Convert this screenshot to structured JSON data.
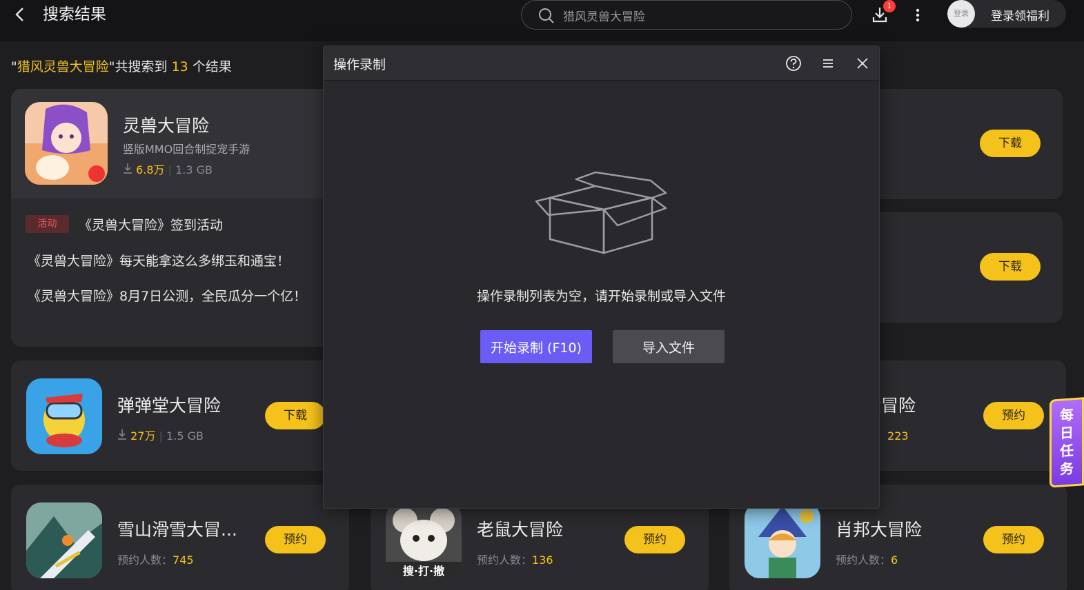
{
  "header": {
    "title": "搜索结果",
    "search_value": "猎风灵兽大冒险",
    "download_badge": "1",
    "login_avatar_text": "登录",
    "login_label": "登录领福利"
  },
  "results": {
    "quote_open": "\"",
    "keyword": "猎风灵兽大冒险",
    "quote_close": "\"",
    "mid_text": "共搜索到",
    "count": "13",
    "suffix": "个结果"
  },
  "featured": {
    "title": "灵兽大冒险",
    "subtitle": "竖版MMO回合制捉宠手游",
    "downloads": "6.8万",
    "size": "1.3 GB",
    "activity_tag": "活动",
    "activity_title": "《灵兽大冒险》签到活动",
    "news": [
      "《灵兽大冒险》每天能拿这么多绑玉和通宝！",
      "《灵兽大冒险》8月7日公测，全民瓜分一个亿！"
    ]
  },
  "right_buttons": {
    "card1": "下载",
    "card2": "下载"
  },
  "games": [
    {
      "title": "弹弹堂大冒险",
      "downloads": "27万",
      "size": "1.5 GB",
      "button": "下载"
    },
    {
      "title_partial": "大冒险",
      "meta_label_partial": "数：",
      "meta_value": "223",
      "button": "预约"
    },
    {
      "title": "雪山滑雪大冒...",
      "meta_label": "预约人数：",
      "meta_value": "745",
      "button": "预约"
    },
    {
      "title": "老鼠大冒险",
      "meta_label": "预约人数：",
      "meta_value": "136",
      "button": "预约",
      "icon_caption": "搜·打·撤"
    },
    {
      "title": "肖邦大冒险",
      "meta_label": "预约人数：",
      "meta_value": "6",
      "button": "预约"
    }
  ],
  "dialog": {
    "title": "操作录制",
    "empty_text": "操作录制列表为空，请开始录制或导入文件",
    "start_button": "开始录制 (F10)",
    "import_button": "导入文件"
  },
  "side_banner": "每日任务",
  "colors": {
    "accent_yellow": "#f4c21b",
    "primary_purple": "#6a5cf5",
    "background": "#1e1e21",
    "card": "#2b2b2f"
  }
}
